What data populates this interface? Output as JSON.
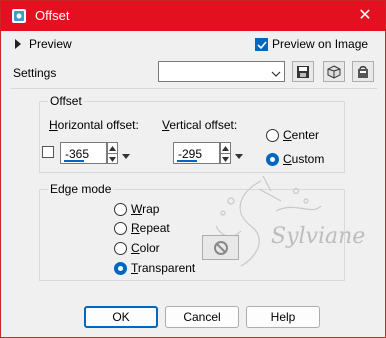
{
  "window": {
    "title": "Offset",
    "close_glyph": "✕"
  },
  "preview": {
    "label": "Preview",
    "on_image_label": "Preview on Image",
    "on_image_checked": true
  },
  "settings": {
    "label": "Settings",
    "value": ""
  },
  "offset_group": {
    "title": "Offset",
    "horizontal_label_accel": "H",
    "horizontal_label_rest": "orizontal offset:",
    "vertical_label_accel": "V",
    "vertical_label_rest": "ertical offset:",
    "horizontal_value": "-365",
    "vertical_value": "-295",
    "center_accel": "C",
    "center_rest": "enter",
    "custom_accel": "C",
    "custom_rest": "ustom",
    "selected": "custom"
  },
  "edge_mode": {
    "title": "Edge mode",
    "wrap_accel": "W",
    "wrap_rest": "rap",
    "repeat_accel": "R",
    "repeat_rest": "epeat",
    "color_accel": "C",
    "color_rest": "olor",
    "transparent_accel": "T",
    "transparent_rest": "ransparent",
    "selected": "transparent"
  },
  "watermark": {
    "text": "Sylviane"
  },
  "buttons": {
    "ok": "OK",
    "cancel": "Cancel",
    "help": "Help"
  },
  "colors": {
    "titlebar": "#e3101f",
    "accent": "#0067c0"
  }
}
